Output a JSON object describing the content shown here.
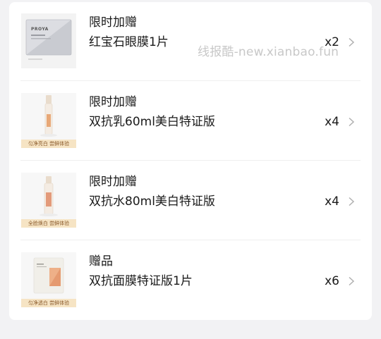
{
  "items": [
    {
      "tag": "限时加赠",
      "name": "红宝石眼膜1片",
      "qty": "x2",
      "thumb": "eye-mask-sachet",
      "brand_text": "PROYA",
      "banner": ""
    },
    {
      "tag": "限时加赠",
      "name": "双抗乳60ml美白特证版",
      "qty": "x4",
      "thumb": "lotion-bottle",
      "brand_text": "",
      "banner": "匀净亮白 尝鲜体验"
    },
    {
      "tag": "限时加赠",
      "name": "双抗水80ml美白特证版",
      "qty": "x4",
      "thumb": "toner-bottle",
      "brand_text": "",
      "banner": "全脸焕白 尝鲜体验"
    },
    {
      "tag": "赠品",
      "name": "双抗面膜特证版1片",
      "qty": "x6",
      "thumb": "face-mask-sachet",
      "brand_text": "",
      "banner": "匀净透白 尝鲜体验"
    }
  ],
  "watermark": "线报酷-new.xianbao.fun",
  "colors": {
    "background": "#f2f2f4",
    "card": "#ffffff",
    "banner": "#f6e4c4",
    "banner_text": "#8a5a2b",
    "text": "#1a1a1a",
    "chevron": "#b0b0b0",
    "watermark": "#c8c8c8"
  }
}
